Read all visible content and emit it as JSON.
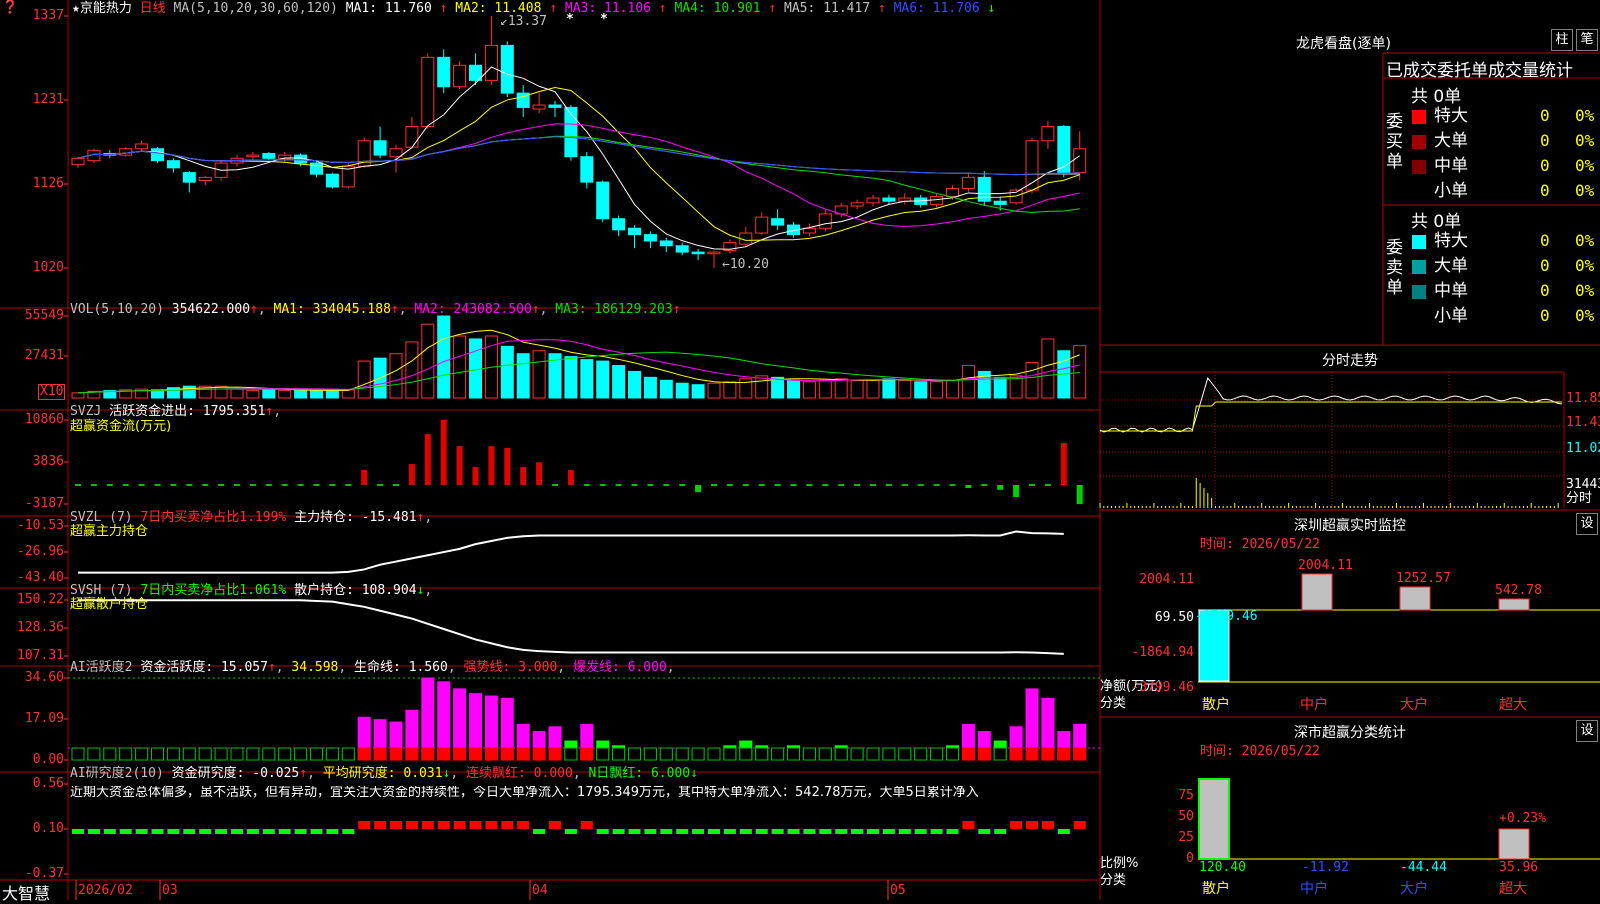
{
  "header": {
    "stock_name": "京能热力",
    "period": "日线",
    "ma_params": "MA(5,10,20,30,60,120)",
    "ma_values": [
      {
        "label": "MA1: 11.760",
        "arrow": "↑",
        "color": "#ffffff"
      },
      {
        "label": "MA2: 11.408",
        "arrow": "↑",
        "color": "#ffff00"
      },
      {
        "label": "MA3: 11.106",
        "arrow": "↑",
        "color": "#ff00ff"
      },
      {
        "label": "MA4: 10.901",
        "arrow": "↑",
        "color": "#00e000"
      },
      {
        "label": "MA5: 11.417",
        "arrow": "↑",
        "color": "#c0c0c0"
      },
      {
        "label": "MA6: 11.706",
        "arrow": "↓",
        "color": "#3050ff"
      }
    ]
  },
  "main_panel": {
    "price_ticks": [
      "1337",
      "1231",
      "1126",
      "1020"
    ],
    "high_label": "13.37",
    "low_label": "10.20",
    "star_marks": [
      "*",
      "*"
    ]
  },
  "vol_panel": {
    "title": "VOL(5,10,20)",
    "value": "354622.000",
    "ma1": "MA1: 334045.188",
    "ma2": "MA2: 243082.500",
    "ma3": "MA3: 186129.203",
    "ticks": [
      "55549",
      "27431"
    ],
    "unit": "X10"
  },
  "svzj_panel": {
    "title": "SVZJ",
    "label": "活跃资金进出: 1795.351",
    "subtitle": "超赢资金流(万元)",
    "ticks": [
      "10860",
      "3836",
      "-3187"
    ]
  },
  "svzl_panel": {
    "title": "SVZL (7)",
    "note": "7日内买卖净占比1.199%",
    "label": "主力持仓: -15.481",
    "subtitle": "超赢主力持仓",
    "ticks": [
      "-10.53",
      "-26.96",
      "-43.40"
    ]
  },
  "svsh_panel": {
    "title": "SVSH (7)",
    "note": "7日内买卖净占比1.061%",
    "label": "散户持仓: 108.904",
    "subtitle": "超赢散户持仓",
    "ticks": [
      "150.22",
      "128.36",
      "107.31"
    ]
  },
  "ai_active_panel": {
    "title": "AI活跃度2",
    "label": "资金活跃度: 15.057",
    "v2": "34.598",
    "life": "生命线: 1.560",
    "strong": "强势线: 3.000",
    "burst": "爆发线: 6.000",
    "ticks": [
      "34.60",
      "17.09",
      "0.00"
    ]
  },
  "ai_research_panel": {
    "title": "AI研究度2(10)",
    "label": "资金研究度: -0.025",
    "avg": "平均研究度: 0.031",
    "red_days": "连续飘红: 0.000",
    "n_days": "N日飘红: 6.000",
    "comment": "近期大资金总体偏多，虽不活跃，但有异动，宜关注大资金的持续性，今日大单净流入：1795.349万元，其中特大单净流入：542.78万元，大单5日累计净入",
    "ticks": [
      "0.56",
      "0.10",
      "-0.37"
    ]
  },
  "date_axis": {
    "brand": "大智慧",
    "labels": [
      "2026/02",
      "03",
      "04",
      "05"
    ]
  },
  "dragon_tiger": {
    "title": "龙虎看盘(逐单)",
    "tab1": "柱",
    "tab2": "笔",
    "table_title": "已成交委托单成交量统计",
    "buy_label": "委买单",
    "sell_label": "委卖单",
    "buy_total": "共 0单",
    "sell_total": "共 0单",
    "buy_rows": [
      {
        "name": "特大",
        "count": "0",
        "pct": "0%",
        "color": "#ff0000"
      },
      {
        "name": "大单",
        "count": "0",
        "pct": "0%",
        "color": "#a00000"
      },
      {
        "name": "中单",
        "count": "0",
        "pct": "0%",
        "color": "#800000"
      },
      {
        "name": "小单",
        "count": "0",
        "pct": "0%",
        "color": "#000000"
      }
    ],
    "sell_rows": [
      {
        "name": "特大",
        "count": "0",
        "pct": "0%",
        "color": "#00ffff"
      },
      {
        "name": "大单",
        "count": "0",
        "pct": "0%",
        "color": "#00a0a0"
      },
      {
        "name": "中单",
        "count": "0",
        "pct": "0%",
        "color": "#008080"
      },
      {
        "name": "小单",
        "count": "0",
        "pct": "0%",
        "color": "#000000"
      }
    ]
  },
  "intraday": {
    "title": "分时走势",
    "ticks": [
      "11.85",
      "11.43",
      "11.02",
      "31443",
      "分时"
    ]
  },
  "sz_monitor": {
    "title": "深圳超赢实时监控",
    "setting": "设",
    "time": "时间: 2026/05/22",
    "ticks": [
      "2004.11",
      "69.50",
      "-1864.94",
      "-3799.46"
    ],
    "ylabel": "净额(万元)",
    "xlabel": "分类"
  },
  "sz_class": {
    "title": "深市超赢分类统计",
    "setting": "设",
    "time": "时间: 2026/05/22",
    "ticks": [
      "75",
      "50",
      "25",
      "0"
    ],
    "ylabel": "比例%",
    "xlabel": "分类",
    "pct_note": "+0.23%"
  },
  "chart_data": [
    {
      "type": "candlestick",
      "name": "日线",
      "ylim": [
        10.2,
        13.37
      ],
      "candles": [
        [
          11.5,
          11.58,
          11.46,
          11.6
        ],
        [
          11.55,
          11.68,
          11.52,
          11.7
        ],
        [
          11.64,
          11.62,
          11.58,
          11.68
        ],
        [
          11.62,
          11.7,
          11.6,
          11.72
        ],
        [
          11.7,
          11.76,
          11.66,
          11.8
        ],
        [
          11.7,
          11.55,
          11.52,
          11.72
        ],
        [
          11.55,
          11.46,
          11.4,
          11.58
        ],
        [
          11.4,
          11.28,
          11.15,
          11.42
        ],
        [
          11.3,
          11.34,
          11.24,
          11.36
        ],
        [
          11.34,
          11.52,
          11.3,
          11.56
        ],
        [
          11.52,
          11.58,
          11.48,
          11.62
        ],
        [
          11.6,
          11.62,
          11.55,
          11.66
        ],
        [
          11.64,
          11.58,
          11.55,
          11.66
        ],
        [
          11.58,
          11.62,
          11.54,
          11.66
        ],
        [
          11.62,
          11.52,
          11.48,
          11.64
        ],
        [
          11.52,
          11.38,
          11.34,
          11.54
        ],
        [
          11.38,
          11.22,
          11.2,
          11.4
        ],
        [
          11.22,
          11.48,
          11.2,
          11.52
        ],
        [
          11.48,
          11.8,
          11.46,
          11.84
        ],
        [
          11.8,
          11.62,
          11.58,
          11.98
        ],
        [
          11.6,
          11.7,
          11.4,
          11.75
        ],
        [
          11.72,
          11.98,
          11.7,
          12.1
        ],
        [
          11.98,
          12.85,
          11.95,
          12.9
        ],
        [
          12.85,
          12.48,
          12.4,
          12.95
        ],
        [
          12.48,
          12.75,
          12.45,
          12.8
        ],
        [
          12.75,
          12.56,
          12.5,
          12.9
        ],
        [
          12.56,
          13.0,
          12.5,
          13.37
        ],
        [
          13.0,
          12.4,
          12.35,
          13.05
        ],
        [
          12.4,
          12.22,
          12.1,
          12.5
        ],
        [
          12.2,
          12.25,
          12.15,
          12.4
        ],
        [
          12.25,
          12.22,
          12.1,
          12.3
        ],
        [
          12.22,
          11.6,
          11.55,
          12.25
        ],
        [
          11.6,
          11.28,
          11.2,
          11.66
        ],
        [
          11.28,
          10.82,
          10.78,
          11.3
        ],
        [
          10.82,
          10.68,
          10.6,
          10.86
        ],
        [
          10.7,
          10.62,
          10.45,
          10.74
        ],
        [
          10.62,
          10.54,
          10.45,
          10.66
        ],
        [
          10.54,
          10.48,
          10.4,
          10.58
        ],
        [
          10.48,
          10.4,
          10.36,
          10.52
        ],
        [
          10.4,
          10.38,
          10.3,
          10.44
        ],
        [
          10.38,
          10.4,
          10.2,
          10.42
        ],
        [
          10.42,
          10.52,
          10.38,
          10.56
        ],
        [
          10.5,
          10.64,
          10.46,
          10.72
        ],
        [
          10.64,
          10.84,
          10.62,
          10.9
        ],
        [
          10.82,
          10.74,
          10.68,
          10.94
        ],
        [
          10.74,
          10.62,
          10.58,
          10.78
        ],
        [
          10.64,
          10.7,
          10.6,
          10.76
        ],
        [
          10.7,
          10.88,
          10.66,
          10.94
        ],
        [
          10.88,
          10.98,
          10.84,
          11.02
        ],
        [
          10.98,
          11.02,
          10.94,
          11.06
        ],
        [
          11.02,
          11.08,
          10.98,
          11.12
        ],
        [
          11.08,
          11.04,
          11.0,
          11.12
        ],
        [
          11.04,
          11.08,
          11.0,
          11.14
        ],
        [
          11.08,
          11.0,
          10.96,
          11.12
        ],
        [
          11.0,
          11.1,
          10.96,
          11.14
        ],
        [
          11.1,
          11.2,
          11.06,
          11.24
        ],
        [
          11.2,
          11.34,
          11.16,
          11.4
        ],
        [
          11.34,
          11.04,
          10.98,
          11.42
        ],
        [
          11.04,
          11.0,
          10.92,
          11.1
        ],
        [
          11.02,
          11.18,
          11.0,
          11.2
        ],
        [
          11.18,
          11.8,
          11.14,
          11.84
        ],
        [
          11.8,
          11.98,
          11.7,
          12.05
        ],
        [
          11.98,
          11.4,
          11.34,
          12.0
        ],
        [
          11.4,
          11.7,
          11.3,
          11.92
        ]
      ]
    },
    {
      "type": "bar",
      "name": "VOL",
      "ylim": [
        0,
        55549
      ],
      "values": [
        3500,
        4500,
        5000,
        5500,
        6000,
        5500,
        7000,
        8000,
        8000,
        8000,
        6000,
        5000,
        5500,
        5000,
        5500,
        5000,
        5000,
        5500,
        25000,
        27000,
        30000,
        38000,
        50000,
        55549,
        42000,
        40000,
        42000,
        35000,
        30000,
        32000,
        30000,
        28000,
        26000,
        25000,
        22000,
        18000,
        14000,
        12000,
        10000,
        9000,
        10000,
        11000,
        13000,
        15000,
        14000,
        12000,
        11000,
        12000,
        13000,
        12000,
        12000,
        13000,
        12000,
        11000,
        11000,
        12000,
        22000,
        18000,
        14000,
        15000,
        24000,
        40000,
        32000,
        35442
      ]
    },
    {
      "type": "bar",
      "name": "活跃资金进出",
      "ylim": [
        -3187,
        10860
      ],
      "values": [
        0,
        0,
        0,
        0,
        0,
        0,
        0,
        0,
        0,
        0,
        0,
        0,
        0,
        0,
        0,
        0,
        0,
        0,
        2500,
        0,
        0,
        3500,
        8500,
        10860,
        6500,
        3000,
        6500,
        6200,
        3000,
        3800,
        0,
        2500,
        0,
        0,
        0,
        0,
        0,
        0,
        0,
        -1200,
        0,
        0,
        0,
        0,
        0,
        0,
        0,
        0,
        0,
        0,
        0,
        0,
        0,
        0,
        0,
        0,
        -500,
        0,
        -800,
        -2000,
        0,
        0,
        7000,
        -3187,
        -1200,
        1795
      ]
    },
    {
      "type": "line",
      "name": "主力持仓",
      "ylim": [
        -43.4,
        -10.53
      ],
      "values": [
        -40,
        -40,
        -40,
        -40,
        -40,
        -40,
        -40,
        -40,
        -40,
        -40,
        -40,
        -40,
        -40,
        -40,
        -40,
        -40,
        -40,
        -39.5,
        -38,
        -35,
        -33,
        -31,
        -29,
        -27,
        -25,
        -22,
        -20,
        -18,
        -17,
        -16.5,
        -16.5,
        -16.5,
        -16.5,
        -16.5,
        -16.5,
        -16.5,
        -16.5,
        -16.5,
        -16.5,
        -16.5,
        -16.5,
        -16.5,
        -16.5,
        -16.5,
        -16.5,
        -16.5,
        -16.5,
        -16.5,
        -16.5,
        -16.5,
        -16.5,
        -16.5,
        -16.5,
        -16.5,
        -16.5,
        -16.5,
        -16.4,
        -16.5,
        -16.5,
        -14,
        -15,
        -15.2,
        -15.481
      ]
    },
    {
      "type": "line",
      "name": "散户持仓",
      "ylim": [
        107.31,
        150.22
      ],
      "values": [
        150,
        150,
        150,
        150,
        150,
        150,
        150,
        150,
        150,
        150,
        150,
        150,
        150,
        150,
        150,
        149.5,
        149,
        147,
        145,
        142,
        139,
        136,
        132,
        128,
        124,
        120,
        117,
        114,
        112,
        111,
        110.5,
        110,
        110,
        110,
        110,
        110,
        110,
        110,
        110,
        110,
        110,
        110,
        110,
        110,
        110,
        110,
        110,
        110,
        110,
        110,
        110,
        110,
        110,
        110,
        110,
        110,
        110,
        110,
        110,
        110.2,
        110,
        109.5,
        108.904
      ]
    },
    {
      "type": "bar",
      "name": "资金活跃度",
      "ylim": [
        0,
        34.6
      ],
      "values": [
        2,
        2,
        2,
        2,
        2,
        2,
        2,
        2,
        2,
        2,
        2,
        2,
        2,
        2,
        2,
        2,
        2,
        2,
        18,
        17,
        16,
        21,
        34.6,
        33,
        30,
        28,
        27,
        26,
        15,
        12,
        14,
        8,
        15,
        8,
        6,
        5,
        4,
        3,
        3,
        4,
        5,
        6,
        8,
        6,
        5,
        6,
        5,
        5,
        6,
        5,
        4,
        4,
        4,
        4,
        5,
        6,
        15,
        12,
        8,
        14,
        30,
        26,
        12,
        15.057
      ]
    }
  ]
}
